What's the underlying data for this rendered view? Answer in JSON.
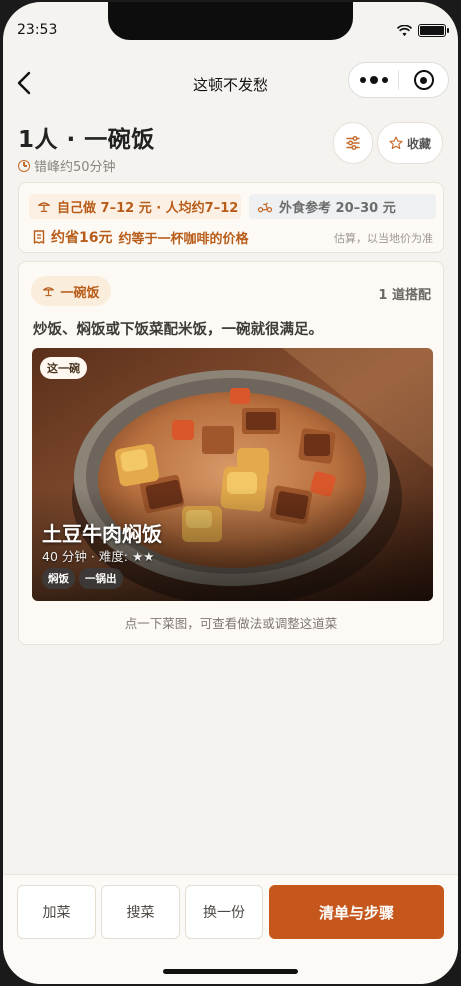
{
  "status": {
    "time": "23:53"
  },
  "nav": {
    "title": "这顿不发愁"
  },
  "header": {
    "title": "1人 · 一碗饭",
    "subtitle": "错峰约50分钟",
    "favorite_label": "收藏"
  },
  "info": {
    "home_cost": "自己做 7–12 元 · 人均约7–12",
    "takeout_ref": "外食参考 20–30 元",
    "save_amount": "约省16元",
    "save_compare": "约等于一杯咖啡的价格",
    "estimate_note": "估算，以当地价为准"
  },
  "meal": {
    "tag": "一碗饭",
    "pair_count": "1 道搭配",
    "description": "炒饭、焖饭或下饭菜配米饭，一碗就很满足。",
    "dish": {
      "badge": "这一碗",
      "name": "土豆牛肉焖饭",
      "meta": "40 分钟 · 难度: ★★",
      "tags": [
        "焖饭",
        "一锅出"
      ]
    },
    "hint": "点一下菜图，可查看做法或调整这道菜"
  },
  "actions": {
    "add": "加菜",
    "search": "搜菜",
    "swap": "换一份",
    "primary": "清单与步骤"
  },
  "colors": {
    "accent": "#c5571c",
    "accent_text": "#b85c1a",
    "background": "#f5f3ef"
  }
}
